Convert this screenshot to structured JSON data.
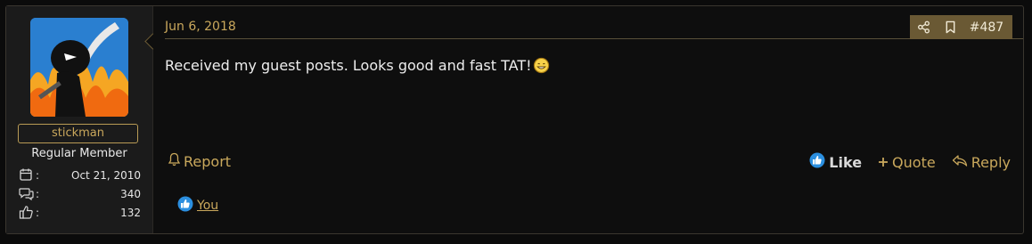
{
  "user": {
    "name": "stickman",
    "title": "Regular Member",
    "stats": [
      {
        "icon": "calendar-icon",
        "value": "Oct 21, 2010"
      },
      {
        "icon": "messages-icon",
        "value": "340"
      },
      {
        "icon": "thumbs-up-icon",
        "value": "132"
      }
    ],
    "stat_separator": ":"
  },
  "post": {
    "date": "Jun 6, 2018",
    "number": "#487",
    "message": "Received my guest posts. Looks good and fast TAT!"
  },
  "actions": {
    "report": "Report",
    "like": "Like",
    "quote": "Quote",
    "reply": "Reply"
  },
  "reactions": {
    "users": "You"
  },
  "colors": {
    "accent_gold": "#caa85c",
    "action_bar": "#6a5934",
    "like_blue": "#2b8fe0"
  }
}
